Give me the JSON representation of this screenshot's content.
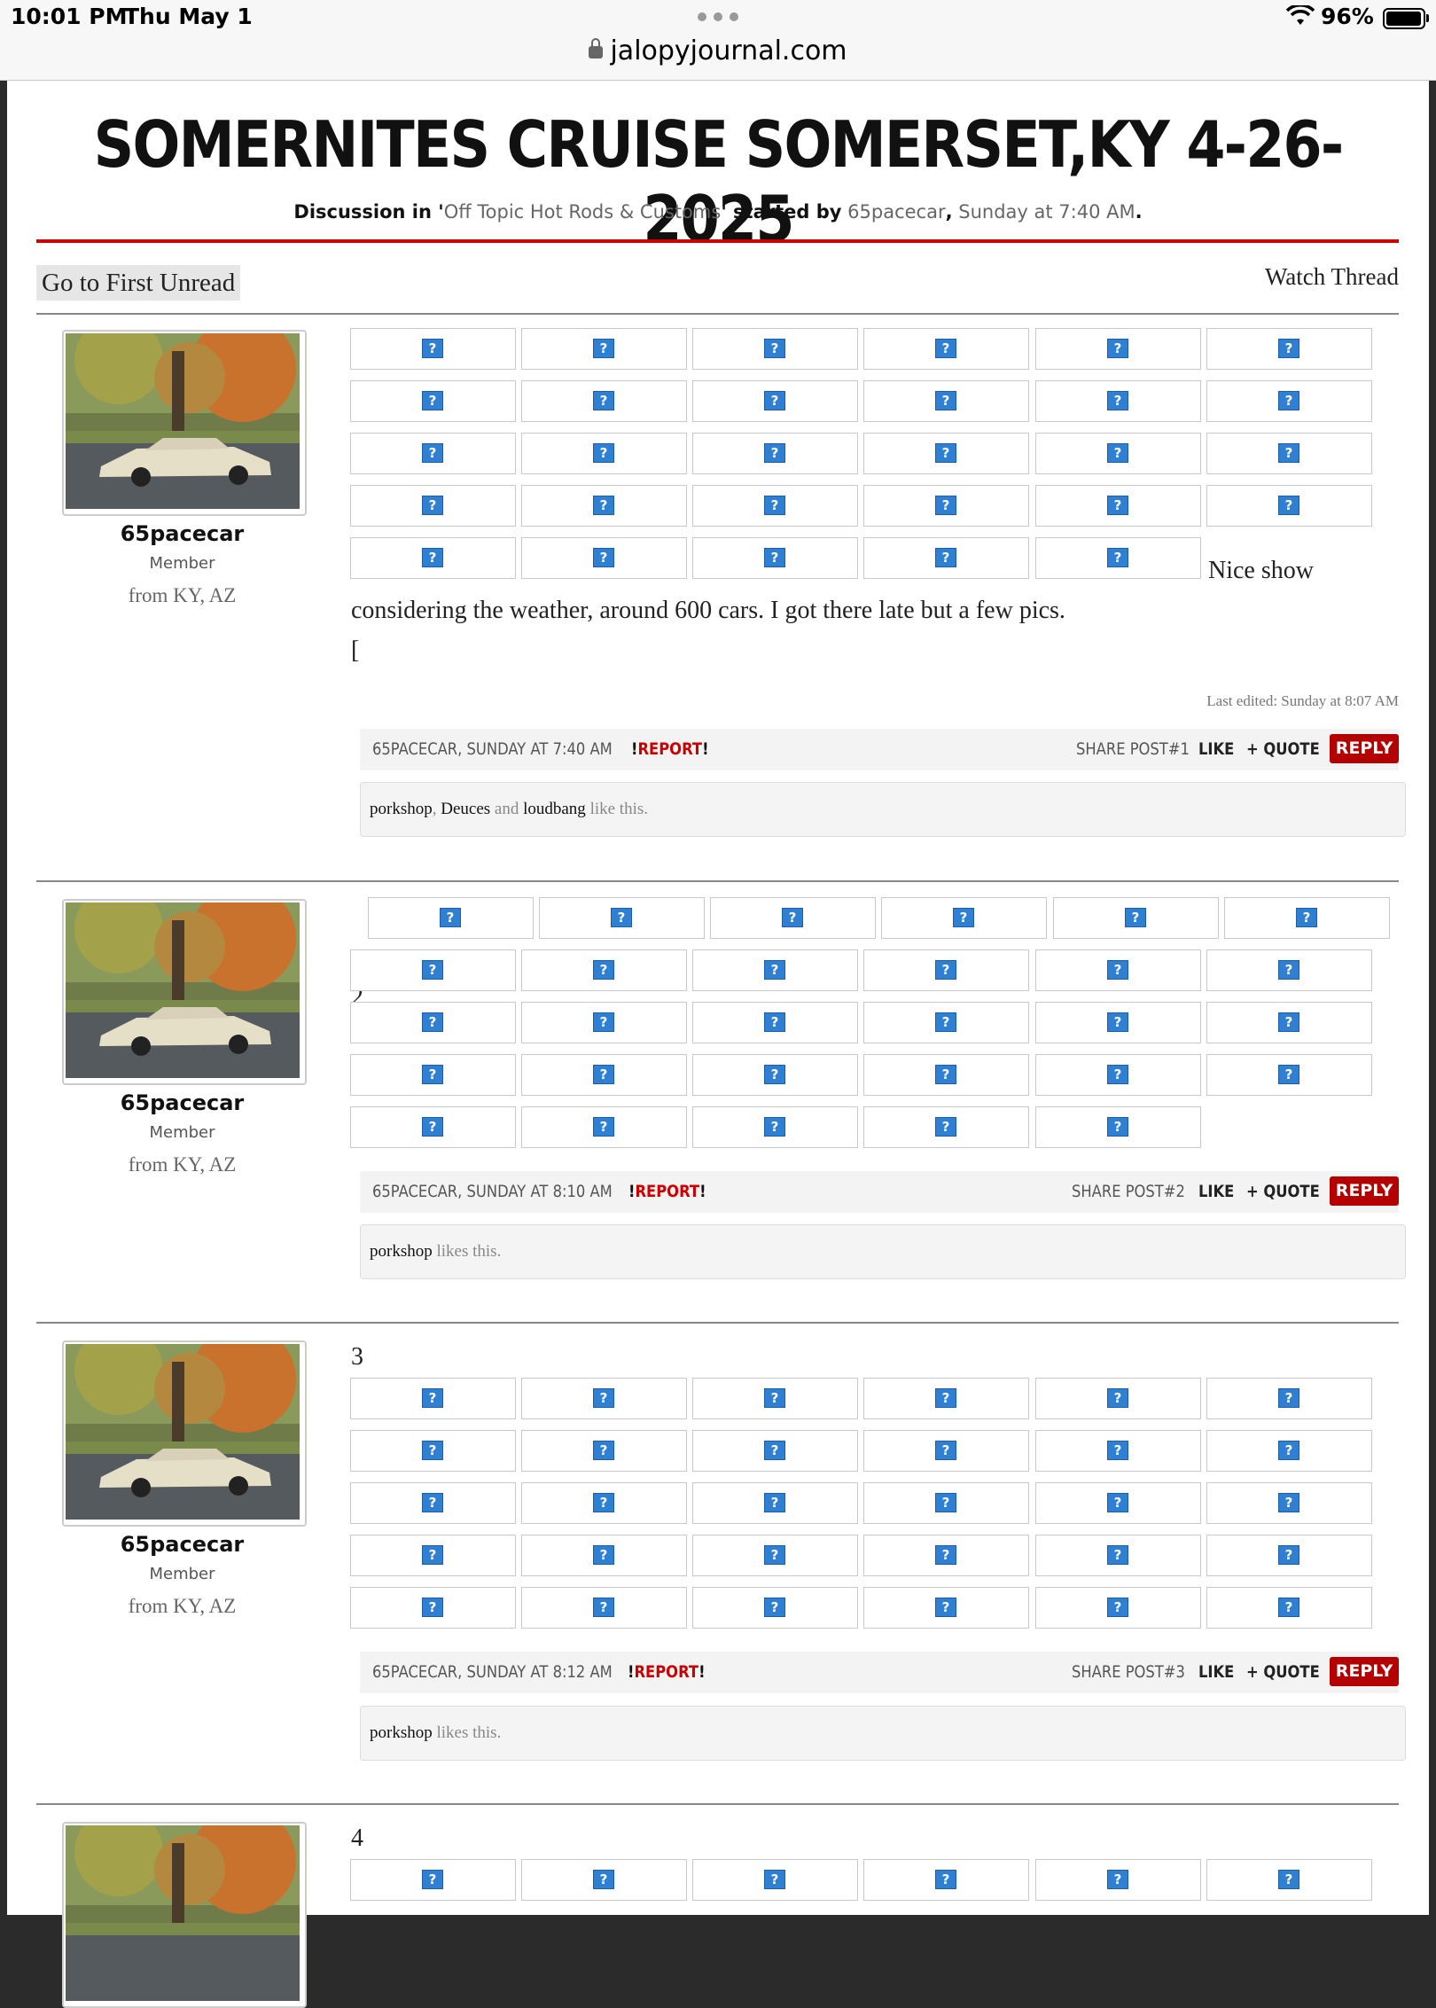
{
  "status": {
    "time": "10:01 PM",
    "date": "Thu May 1",
    "battery": "96%",
    "url": "jalopyjournal.com"
  },
  "thread": {
    "title": "SOMERNITES CRUISE SOMERSET,KY 4-26-2025",
    "meta_prefix": "Discussion in '",
    "forum": "Off Topic Hot Rods & Customs",
    "meta_started": "' started by",
    "starter": "65pacecar",
    "meta_comma": ",",
    "started_at": "Sunday at 7:40 AM",
    "meta_end": ".",
    "first_unread": "Go to First Unread",
    "watch": "Watch Thread"
  },
  "user": {
    "name": "65pacecar",
    "title": "Member",
    "from": "from KY, AZ"
  },
  "icons": {
    "broken_image": "?"
  },
  "posts": [
    {
      "number": "1",
      "text_inline": "Nice show",
      "text_line": "considering the weather, around 600 cars. I got there late but a few pics.",
      "text_bracket": "[",
      "last_edited": "Last edited: Sunday at 8:07 AM",
      "author_line": "65PACECAR, SUNDAY AT 7:40 AM",
      "report": "REPORT",
      "report_bang": "!",
      "share": "SHARE POST#1",
      "like": "LIKE",
      "quote": "+ QUOTE",
      "reply": "REPLY",
      "likes": {
        "u1": "porkshop",
        "sep1": ",",
        "u2": "Deuces",
        "and": "and",
        "u3": "loudbang",
        "tail": "like this."
      }
    },
    {
      "number": "2",
      "author_line": "65PACECAR, SUNDAY AT 8:10 AM",
      "report": "REPORT",
      "report_bang": "!",
      "share": "SHARE POST#2",
      "like": "LIKE",
      "quote": "+ QUOTE",
      "reply": "REPLY",
      "likes": {
        "u1": "porkshop",
        "tail": "likes this."
      }
    },
    {
      "number": "3",
      "author_line": "65PACECAR, SUNDAY AT 8:12 AM",
      "report": "REPORT",
      "report_bang": "!",
      "share": "SHARE POST#3",
      "like": "LIKE",
      "quote": "+ QUOTE",
      "reply": "REPLY",
      "likes": {
        "u1": "porkshop",
        "tail": "likes this."
      }
    },
    {
      "number": "4"
    }
  ]
}
